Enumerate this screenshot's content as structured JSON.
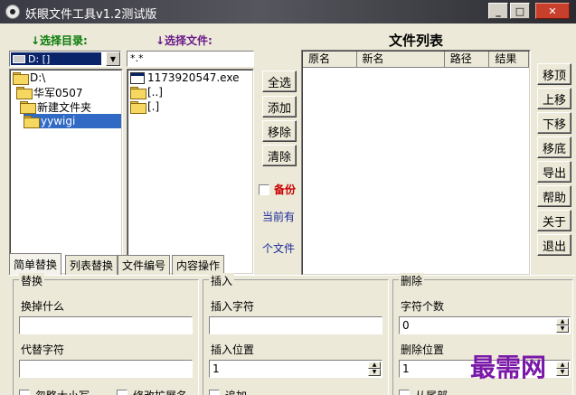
{
  "window": {
    "title": "妖眼文件工具v1.2测试版",
    "minimize": "_",
    "maximize": "□",
    "close": "✕"
  },
  "left": {
    "dir_label": "↓选择目录:",
    "file_label": "↓选择文件:",
    "drive": "D: []",
    "tree": [
      "D:\\",
      "华军0507",
      "新建文件夹",
      "yywigi"
    ],
    "filter": "*.*",
    "files": [
      "1173920547.exe",
      "[..]",
      "[.]"
    ]
  },
  "middle": {
    "buttons": [
      "全选",
      "添加",
      "移除",
      "清除"
    ],
    "backup_label": "备份",
    "current_label": "当前有",
    "count_label": "个文件"
  },
  "list": {
    "title": "文件列表",
    "columns": [
      "原名",
      "新名",
      "路径",
      "结果"
    ]
  },
  "right_buttons": [
    "移顶",
    "上移",
    "下移",
    "移底",
    "导出",
    "帮助",
    "关于",
    "退出"
  ],
  "tabs": [
    "简单替换",
    "列表替换",
    "文件编号",
    "内容操作"
  ],
  "replace": {
    "title": "替换",
    "find_label": "换掉什么",
    "find_value": "",
    "with_label": "代替字符",
    "with_value": "",
    "ignore_case": "忽略大小写",
    "change_ext": "修改扩展名"
  },
  "insert": {
    "title": "插入",
    "char_label": "插入字符",
    "char_value": "",
    "pos_label": "插入位置",
    "pos_value": "1",
    "append": "追加"
  },
  "delete": {
    "title": "删除",
    "count_label": "字符个数",
    "count_value": "0",
    "pos_label": "删除位置",
    "pos_value": "1",
    "from_end": "从尾部"
  },
  "watermark": "最需网"
}
